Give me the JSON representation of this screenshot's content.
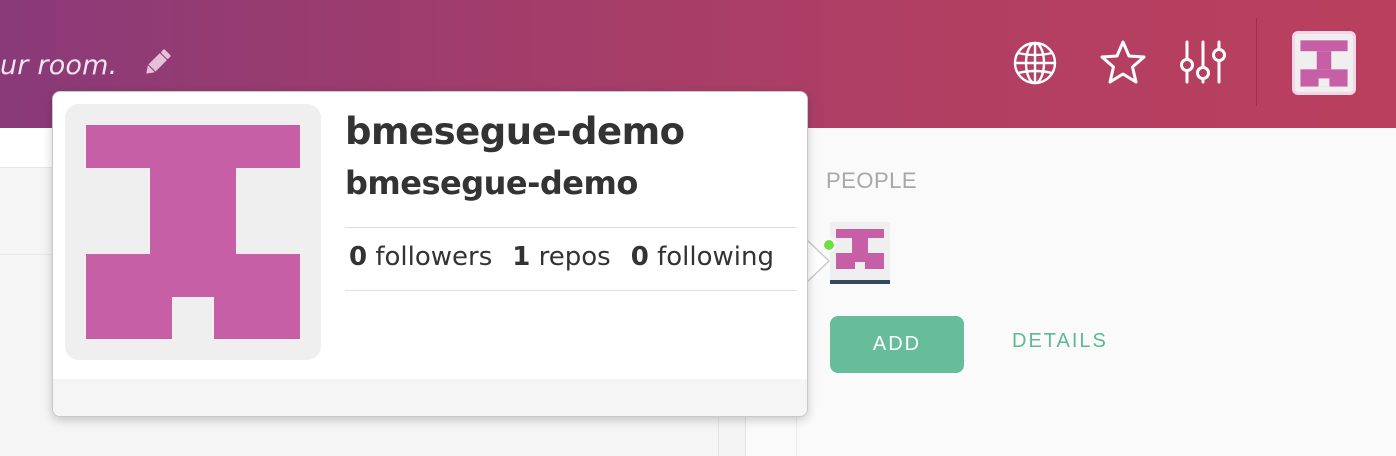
{
  "header": {
    "topic_text": "ur room.",
    "edit_icon": "pencil-icon",
    "actions": [
      {
        "icon": "globe-icon"
      },
      {
        "icon": "star-icon"
      },
      {
        "icon": "settings-sliders-icon"
      }
    ],
    "room_avatar_icon": "room-avatar"
  },
  "profile_popover": {
    "display_name": "bmesegue-demo",
    "username": "bmesegue-demo",
    "stats": {
      "followers_count": "0",
      "followers_label": "followers",
      "repos_count": "1",
      "repos_label": "repos",
      "following_count": "0",
      "following_label": "following"
    }
  },
  "people": {
    "label": "PEOPLE",
    "members": [
      {
        "status": "online"
      }
    ],
    "add_label": "ADD",
    "details_label": "DETAILS"
  },
  "colors": {
    "header_start": "#8a3a78",
    "header_end": "#ba3f5e",
    "avatar_pink": "#c75fa7",
    "add_button": "#67bc9a",
    "details_text": "#5fb994",
    "online": "#6ee043"
  }
}
